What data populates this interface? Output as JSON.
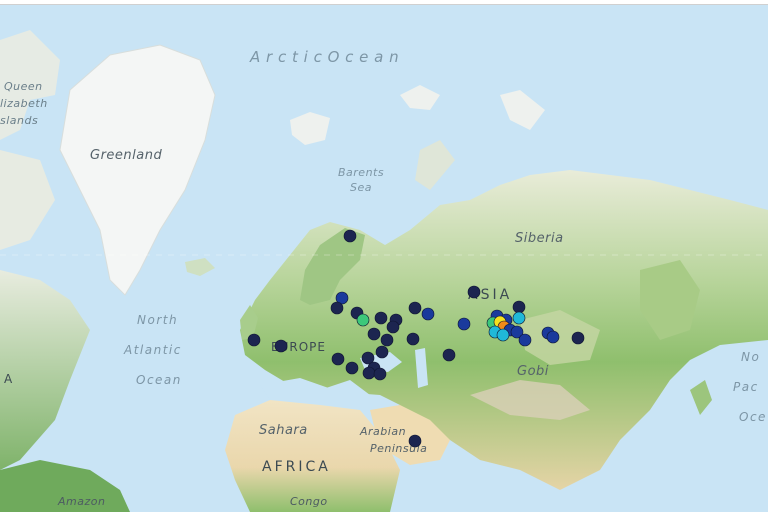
{
  "labels": [
    {
      "id": "arctic-ocean",
      "text": "A r c t i c     O c e a n",
      "kind": "ocean"
    },
    {
      "id": "queen-elizabeth-1",
      "text": "Queen",
      "kind": "place"
    },
    {
      "id": "queen-elizabeth-2",
      "text": "lizabeth",
      "kind": "place"
    },
    {
      "id": "queen-elizabeth-3",
      "text": "slands",
      "kind": "place"
    },
    {
      "id": "greenland",
      "text": "Greenland",
      "kind": "place"
    },
    {
      "id": "barents-1",
      "text": "Barents",
      "kind": "ocean"
    },
    {
      "id": "barents-2",
      "text": "Sea",
      "kind": "ocean"
    },
    {
      "id": "siberia",
      "text": "Siberia",
      "kind": "place"
    },
    {
      "id": "asia",
      "text": "ASIA",
      "kind": "continent"
    },
    {
      "id": "north-atlantic-1",
      "text": "North",
      "kind": "ocean"
    },
    {
      "id": "north-atlantic-2",
      "text": "Atlantic",
      "kind": "ocean"
    },
    {
      "id": "north-atlantic-3",
      "text": "Ocean",
      "kind": "ocean"
    },
    {
      "id": "europe",
      "text": "EUROPE",
      "kind": "continent"
    },
    {
      "id": "gobi",
      "text": "Gobi",
      "kind": "place"
    },
    {
      "id": "sahara",
      "text": "Sahara",
      "kind": "place"
    },
    {
      "id": "arabian-1",
      "text": "Arabian",
      "kind": "place"
    },
    {
      "id": "arabian-2",
      "text": "Peninsula",
      "kind": "place"
    },
    {
      "id": "africa",
      "text": "AFRICA",
      "kind": "continent"
    },
    {
      "id": "amazon",
      "text": "Amazon",
      "kind": "place"
    },
    {
      "id": "congo",
      "text": "Congo",
      "kind": "place"
    },
    {
      "id": "north-pacific-1",
      "text": "No",
      "kind": "ocean"
    },
    {
      "id": "north-pacific-2",
      "text": "Pac",
      "kind": "ocean"
    },
    {
      "id": "north-pacific-3",
      "text": "Oce",
      "kind": "ocean"
    },
    {
      "id": "a-left",
      "text": "A",
      "kind": "continent"
    }
  ],
  "marker_colors": {
    "navy": "#1c2550",
    "blue": "#1a3a9c",
    "cyan": "#20b8d8",
    "green": "#3cc87a",
    "yellow": "#f4e020",
    "orange": "#f08a1a"
  }
}
